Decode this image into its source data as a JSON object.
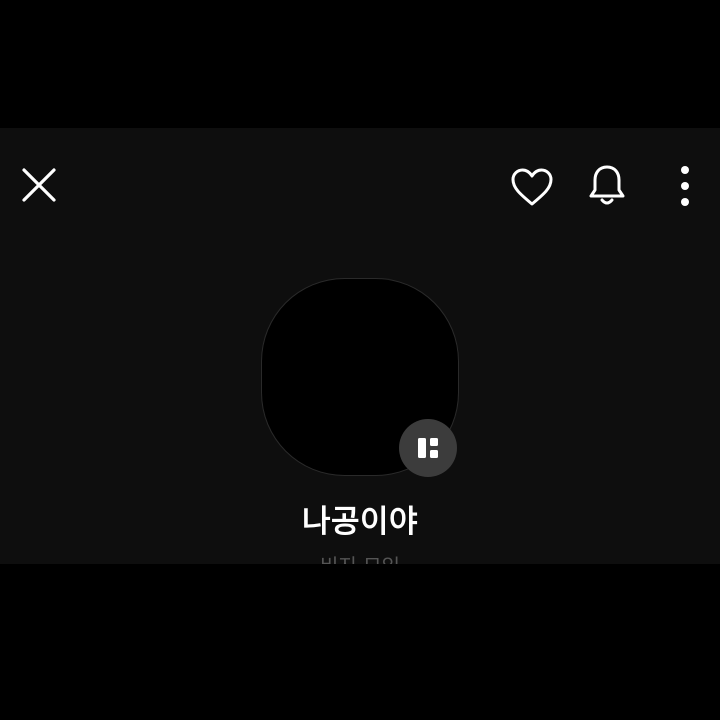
{
  "header": {
    "close_icon": "close-icon",
    "like_icon": "heart-outline-icon",
    "notification_icon": "bell-icon",
    "more_icon": "vertical-ellipsis-icon"
  },
  "profile": {
    "name": "나공이야",
    "status_text": "비지 모임",
    "badge_icon": "channel-grid-icon"
  },
  "colors": {
    "background": "#0e0e0e",
    "letterbox": "#000000",
    "icon": "#ffffff",
    "badge": "#3c3c3c",
    "muted_text": "#555555"
  }
}
